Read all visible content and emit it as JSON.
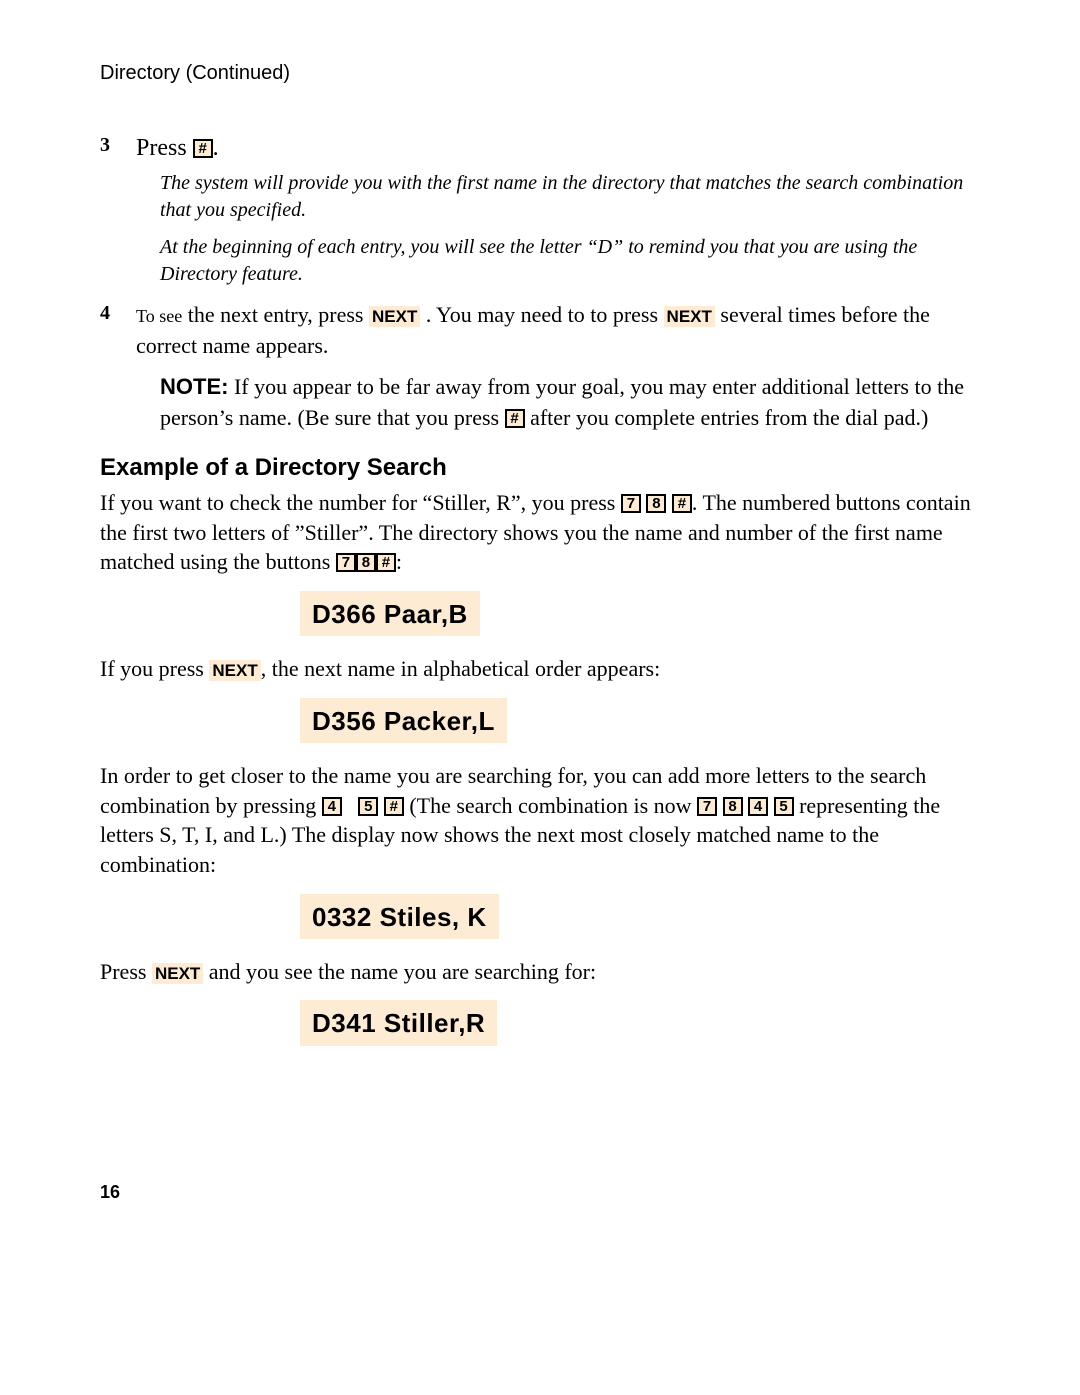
{
  "header": "Directory (Continued)",
  "step3": {
    "num": "3",
    "prefix": "Press ",
    "key": "#",
    "suffix": ".",
    "italic1": "The system will provide you with the first name in the directory that matches the search combination that you specified.",
    "italic2": "At the beginning of each entry, you will see the letter “D” to remind you that you are using the Directory feature."
  },
  "step4": {
    "num": "4",
    "line1_a": "To see",
    "line1_b": " the next entry, press ",
    "next": "NEXT",
    "line1_c": " . You may need to to press ",
    "line1_d": " several times before the correct name appears.",
    "note_label": "NOTE:",
    "note_a": " If you appear to be far away from your goal, you may enter additional letters to the person’s name. (Be sure that you press ",
    "note_key": "#",
    "note_b": " after you complete entries from the dial pad.)"
  },
  "example": {
    "heading": "Example of a Directory Search",
    "p1_a": "If you want to check the number for “Stiller, R”, you press ",
    "k7": "7",
    "k8": "8",
    "khash": "#",
    "p1_b": ".  The numbered buttons contain the first two letters of ”Stiller”.   The directory shows you the name and number of the first name matched using the buttons  ",
    "p1_c": ":",
    "disp1": "D366  Paar,B",
    "p2_a": "If you press ",
    "p2_b": ", the next name in alphabetical order appears:",
    "disp2": "D356 Packer,L",
    "p3_a": "In order to get closer to the name you are searching for, you can add more letters to the search combination by pressing   ",
    "k4": "4",
    "k5": "5",
    "p3_b": " (The search combination is now ",
    "p3_c": " representing the letters S, T, I, and L.) The display now shows the next most closely matched name to the combination:",
    "disp3": "0332  Stiles,  K",
    "p4_a": "Press ",
    "p4_b": " and you see the name you are searching for:",
    "disp4": "D341  Stiller,R"
  },
  "pagenum": "16"
}
